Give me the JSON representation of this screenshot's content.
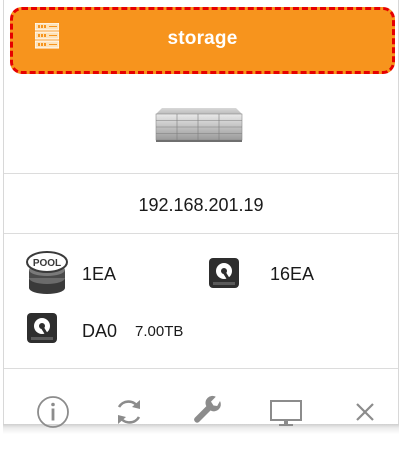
{
  "header": {
    "title": "storage",
    "icon": "server-rack-icon",
    "background_color": "#f7941d",
    "highlight_border_color": "#e60000"
  },
  "device": {
    "image": "storage-device-image",
    "ip_address": "192.168.201.19"
  },
  "summary": {
    "pool": {
      "icon": "pool-icon",
      "icon_text": "POOL",
      "count": "1EA"
    },
    "disks": {
      "icon": "disk-icon",
      "count": "16EA"
    },
    "volume": {
      "icon": "disk-icon",
      "name": "DA0",
      "size": "7.00TB"
    }
  },
  "actions": [
    {
      "icon": "info-icon"
    },
    {
      "icon": "refresh-icon"
    },
    {
      "icon": "wrench-icon"
    },
    {
      "icon": "monitor-icon"
    },
    {
      "icon": "close-icon"
    }
  ],
  "colors": {
    "text": "#1a1a1a",
    "action_icon": "#8c8c8c",
    "divider": "#dcdcdc"
  }
}
